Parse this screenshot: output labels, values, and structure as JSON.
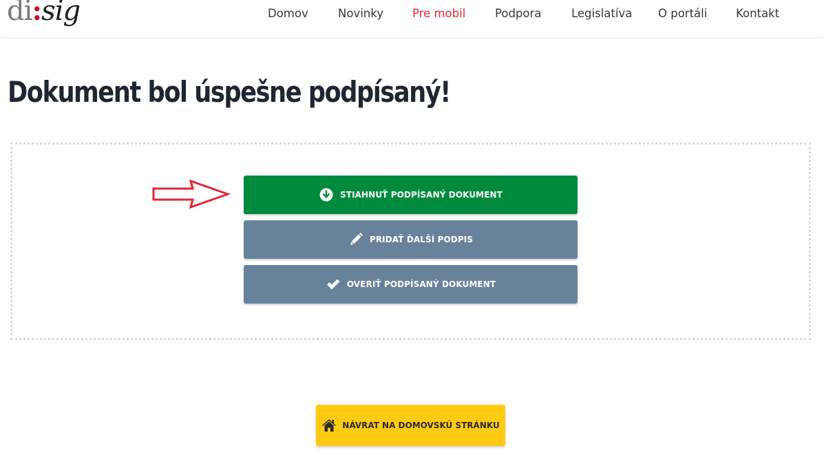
{
  "header": {
    "logo": {
      "part_a": "di",
      "part_b": ":",
      "part_c": "sig"
    },
    "nav": [
      {
        "label": "Domov"
      },
      {
        "label": "Novinky"
      },
      {
        "label": "Pre mobil",
        "active": true
      },
      {
        "label": "Podpora"
      },
      {
        "label": "Legislatíva"
      },
      {
        "label": "O portáli"
      },
      {
        "label": "Kontakt"
      }
    ]
  },
  "main": {
    "title": "Dokument bol úspešne podpísaný!",
    "actions": [
      {
        "label": "STIAHNUŤ PODPÍSANÝ DOKUMENT",
        "icon": "download-circle-icon",
        "color": "#008a3d"
      },
      {
        "label": "PRIDAŤ ĎALŠÍ PODPIS",
        "icon": "pencil-icon",
        "color": "#68829b"
      },
      {
        "label": "OVERIŤ PODPÍSANÝ DOKUMENT",
        "icon": "checkmark-icon",
        "color": "#68829b"
      }
    ],
    "annotation_arrow_color": "#e3262f",
    "home_button": {
      "label": "NÁVRAT NA DOMOVSKÚ STRÁNKU",
      "icon": "home-icon",
      "color": "#fecb12"
    }
  }
}
